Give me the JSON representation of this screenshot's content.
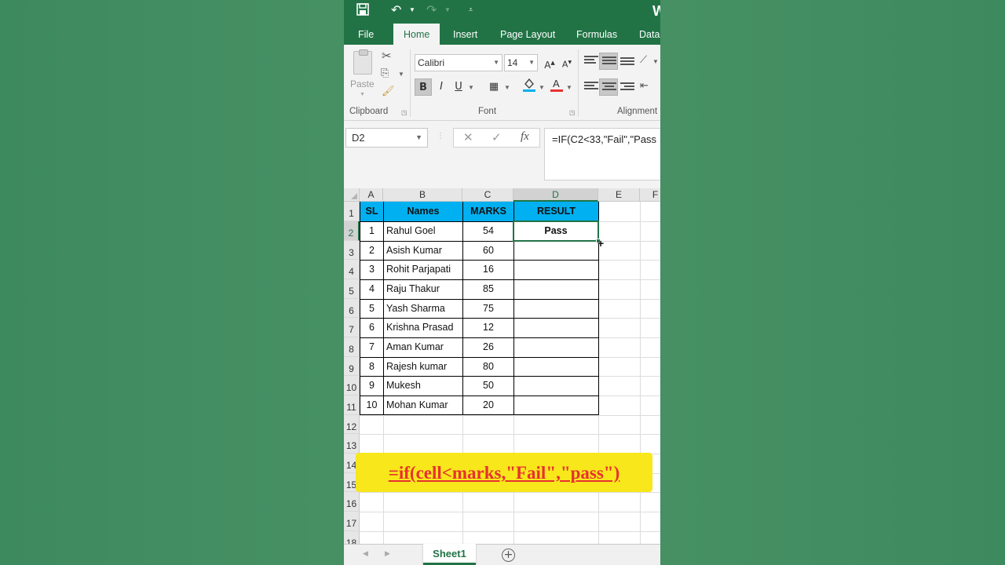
{
  "titlebar": {
    "save_icon": "save-icon",
    "undo_icon": "undo-icon",
    "redo_icon": "redo-icon",
    "app_mark": "W"
  },
  "tabs": [
    "File",
    "Home",
    "Insert",
    "Page Layout",
    "Formulas",
    "Data"
  ],
  "active_tab": "Home",
  "ribbon": {
    "clipboard": {
      "paste_label": "Paste",
      "group_label": "Clipboard"
    },
    "font": {
      "font_name": "Calibri",
      "font_size": "14",
      "group_label": "Font",
      "bold": "B",
      "italic": "I",
      "underline": "U"
    },
    "alignment": {
      "group_label": "Alignment"
    }
  },
  "formula_bar": {
    "name_box": "D2",
    "cancel": "✕",
    "enter": "✓",
    "fx": "fx",
    "formula": "=IF(C2<33,\"Fail\",\"Pass"
  },
  "columns": [
    "A",
    "B",
    "C",
    "D",
    "E",
    "F"
  ],
  "selected_column": "D",
  "rows": [
    "1",
    "2",
    "3",
    "4",
    "5",
    "6",
    "7",
    "8",
    "9",
    "10",
    "11",
    "12",
    "13",
    "14",
    "15",
    "16",
    "17",
    "18"
  ],
  "table": {
    "headers": [
      "SL",
      "Names",
      "MARKS",
      "RESULT"
    ],
    "rows": [
      [
        "1",
        "Rahul Goel",
        "54",
        "Pass"
      ],
      [
        "2",
        "Asish Kumar",
        "60",
        ""
      ],
      [
        "3",
        "Rohit Parjapati",
        "16",
        ""
      ],
      [
        "4",
        "Raju Thakur",
        "85",
        ""
      ],
      [
        "5",
        "Yash Sharma",
        "75",
        ""
      ],
      [
        "6",
        "Krishna Prasad",
        "12",
        ""
      ],
      [
        "7",
        "Aman Kumar",
        "26",
        ""
      ],
      [
        "8",
        "Rajesh kumar",
        "80",
        ""
      ],
      [
        "9",
        "Mukesh",
        "50",
        ""
      ],
      [
        "10",
        "Mohan Kumar",
        "20",
        ""
      ]
    ]
  },
  "caption": "=if(cell<marks,\"Fail\",\"pass\")",
  "sheet_tab": "Sheet1",
  "add_sheet": "+",
  "colors": {
    "excel_green": "#217346",
    "header_fill": "#00b0f0",
    "caption_bg": "#f7e71b",
    "caption_text": "#e8312f",
    "page_bg": "#4a9366"
  }
}
